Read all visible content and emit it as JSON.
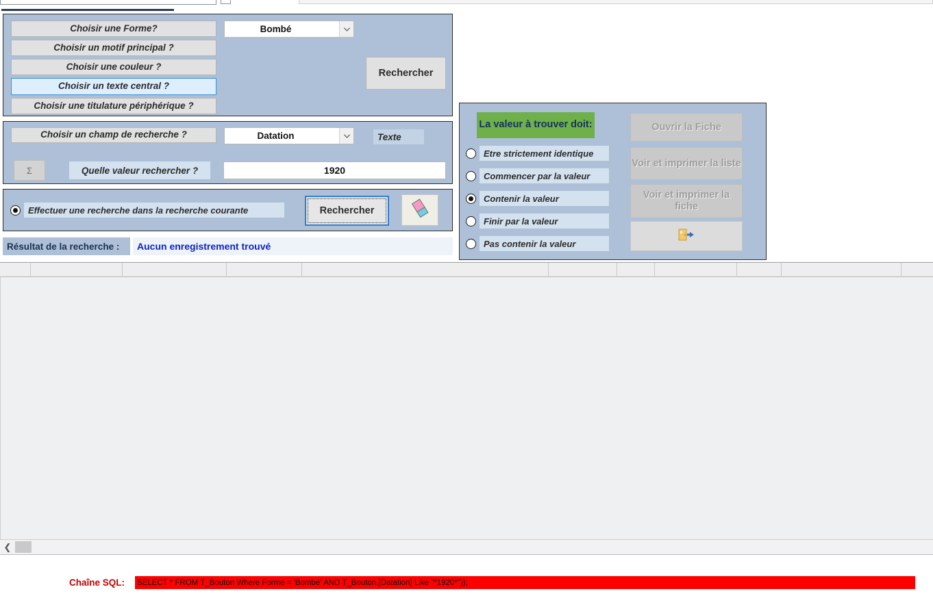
{
  "window": {
    "title": ""
  },
  "criteria_panel": {
    "buttons": [
      {
        "label": "Choisir une Forme?",
        "selected": false
      },
      {
        "label": "Choisir un motif principal ?",
        "selected": false
      },
      {
        "label": "Choisir une couleur ?",
        "selected": false
      },
      {
        "label": "Choisir un texte central ?",
        "selected": true
      },
      {
        "label": "Choisir une titulature périphérique ?",
        "selected": false
      }
    ],
    "forme_combo": {
      "value": "Bombé",
      "arrow_icon": "chevron-down-icon"
    },
    "search_button": "Rechercher"
  },
  "field_panel": {
    "field_button": "Choisir un champ de recherche ?",
    "field_combo": {
      "value": "Datation",
      "arrow_icon": "chevron-down-icon"
    },
    "type_label": "Texte",
    "sigma_button": "Σ",
    "value_label": "Quelle valeur rechercher ?",
    "value_input": "1920"
  },
  "action_panel": {
    "scope_radio": {
      "label": "Effectuer une recherche dans la recherche courante",
      "selected": true
    },
    "search_button": "Rechercher",
    "eraser_button_icon": "eraser-icon"
  },
  "result_row": {
    "label": "Résultat de la recherche :",
    "value": "Aucun enregistrement trouvé"
  },
  "match_panel": {
    "header": "La valeur à trouver doit:",
    "header_color": "#6fb04a",
    "options": [
      {
        "label": "Etre strictement identique",
        "selected": false
      },
      {
        "label": "Commencer par la valeur",
        "selected": false
      },
      {
        "label": "Contenir la valeur",
        "selected": true
      },
      {
        "label": "Finir par la valeur",
        "selected": false
      },
      {
        "label": "Pas contenir la valeur",
        "selected": false
      }
    ],
    "buttons": [
      {
        "label": "Ouvrir la Fiche",
        "disabled": true
      },
      {
        "label": "Voir et imprimer la liste",
        "disabled": true
      },
      {
        "label": "Voir et imprimer la fiche",
        "disabled": true
      }
    ],
    "exit_button_icon": "exit-door-icon"
  },
  "datasheet": {
    "column_dividers": [
      44,
      178,
      330,
      440,
      800,
      900,
      955,
      1075,
      1140,
      1315
    ],
    "rows": [],
    "scroll_prev_icon": "chevron-left-icon"
  },
  "footer": {
    "sql_label": "Chaîne SQL:",
    "sql_value": "SELECT * FROM T_Bouton Where Forme = 'Bombé' AND T_Bouton.[Datation] Like \"*1920*\"));",
    "sql_bg_color": "#ff0000"
  }
}
